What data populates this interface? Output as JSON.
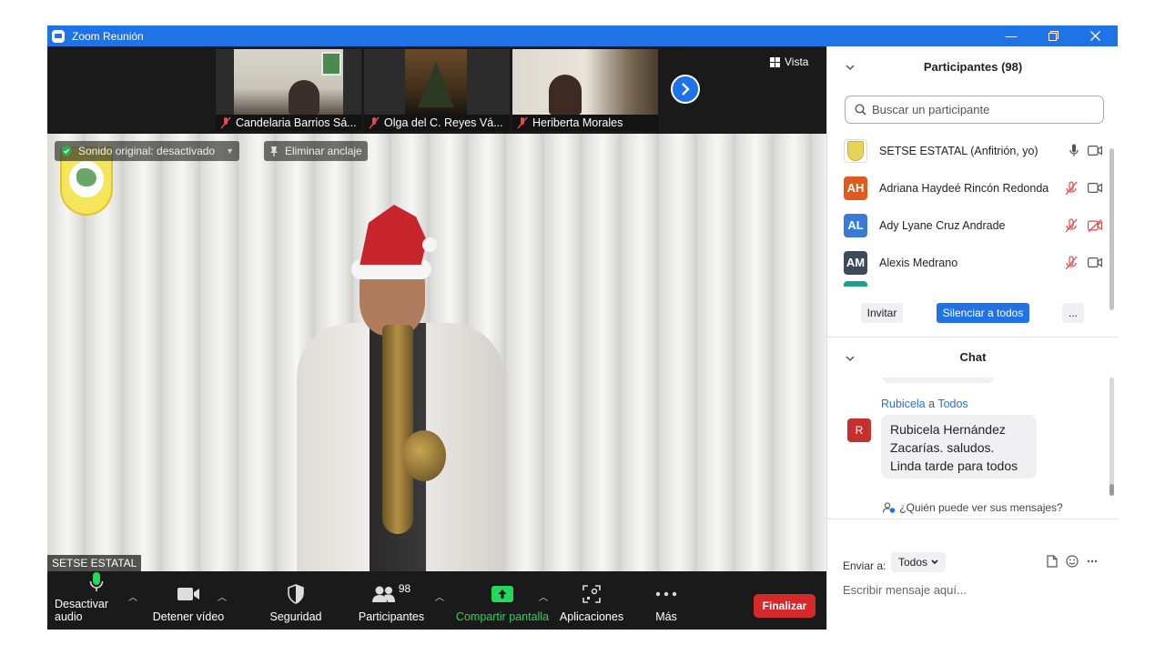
{
  "window": {
    "title": "Zoom Reunión"
  },
  "top_strip": {
    "thumbnails": [
      {
        "name": "Candelaria Barrios Sá..."
      },
      {
        "name": "Olga del C. Reyes Vá..."
      },
      {
        "name": "Heriberta Morales"
      }
    ],
    "view_label": "Vista"
  },
  "main_video": {
    "original_sound": "Sonido original: desactivado",
    "unpin": "Eliminar anclaje",
    "speaker": "SETSE ESTATAL"
  },
  "toolbar": {
    "audio": "Desactivar audio",
    "video": "Detener vídeo",
    "security": "Seguridad",
    "participants": "Participantes",
    "participants_count": "98",
    "share": "Compartir pantalla",
    "apps": "Aplicaciones",
    "more": "Más",
    "end": "Finalizar",
    "share_color": "#23d959",
    "end_color": "#d5292b"
  },
  "participants_panel": {
    "title": "Participantes (98)",
    "search_placeholder": "Buscar un participante",
    "participants": [
      {
        "name": "SETSE ESTATAL (Anfitrión, yo)",
        "initials": "",
        "color": "#e8d35a",
        "mic": "on",
        "video": "on"
      },
      {
        "name": "Adriana Haydeé Rincón Redonda",
        "initials": "AH",
        "color": "#e05a1c",
        "mic": "muted",
        "video": "on"
      },
      {
        "name": "Ady Lyane Cruz Andrade",
        "initials": "AL",
        "color": "#3a7bd5",
        "mic": "muted",
        "video": "off"
      },
      {
        "name": "Alexis Medrano",
        "initials": "AM",
        "color": "#3d4a5c",
        "mic": "muted",
        "video": "on"
      }
    ],
    "invite": "Invitar",
    "mute_all": "Silenciar a todos",
    "more": "..."
  },
  "chat_panel": {
    "title": "Chat",
    "sender": "Rubicela",
    "to_word": "a",
    "recipient": "Todos",
    "avatar_initial": "R",
    "message_lines": [
      "Rubicela Hernández",
      "Zacarías.  saludos.",
      "Linda tarde para todos"
    ],
    "who_can_see": "¿Quién puede ver sus mensajes?",
    "send_to_label": "Enviar a:",
    "send_to_value": "Todos",
    "input_placeholder": "Escribir mensaje aquí..."
  }
}
